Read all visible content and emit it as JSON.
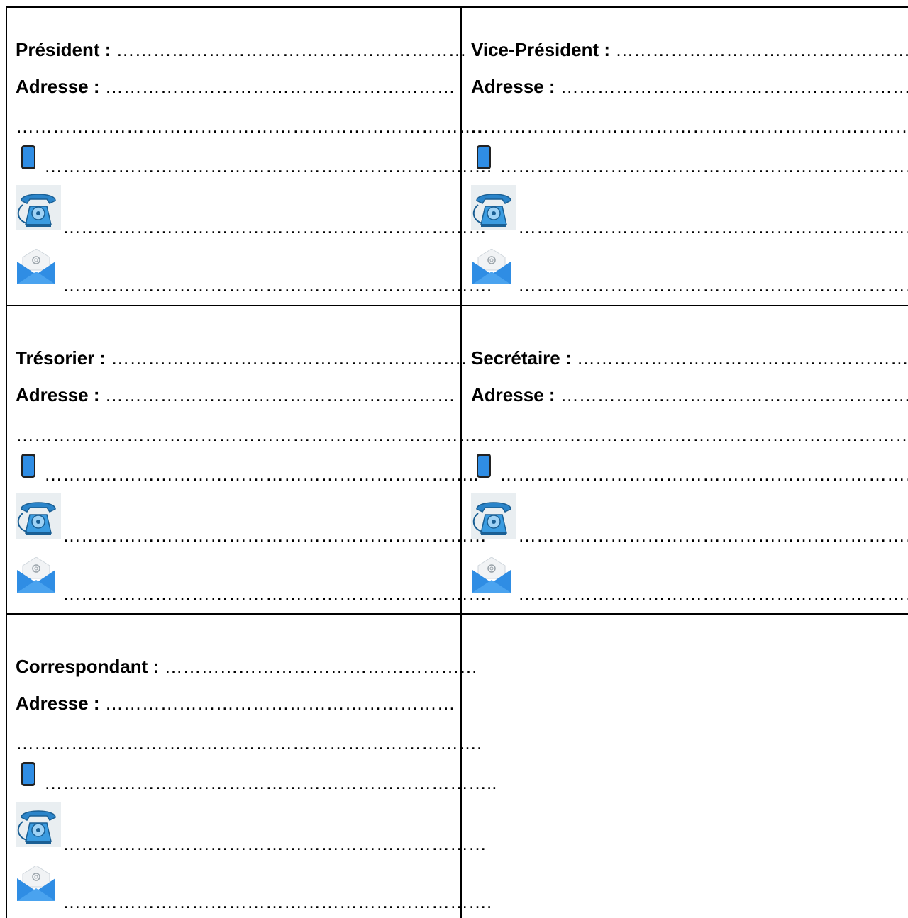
{
  "cards": [
    {
      "label": "Président",
      "sep": " :",
      "name_dots": " …………………………………………………",
      "address_label": "Adresse :",
      "address_dots": " …………………………………………………",
      "address_line2": "………………………………………………………………….",
      "mobile_dots": "……………………………………………………………….",
      "tel_dots": "……………………………………………………………",
      "email_dots": "……………………………………………………………."
    },
    {
      "label": "Vice-Président",
      "sep": " :",
      "name_dots": " ………………………………………………",
      "address_label": "Adresse :",
      "address_dots": " …………………………………………………",
      "address_line2": "……………………………………………………………….…",
      "mobile_dots": " ……………………………………………………………..",
      "tel_dots": "……………………………………………………………",
      "email_dots": " …………………………………………………………….."
    },
    {
      "label": "Trésorier",
      "sep": " :",
      "name_dots": " ………………………………………………….",
      "address_label": "Adresse :",
      "address_dots": " …………………………………………………",
      "address_line2": "………………………………………………………………….",
      "mobile_dots": " ……………………………………………………………..",
      "tel_dots": "……………………………………………………………",
      "email_dots": " ……………………………………………………………."
    },
    {
      "label": "Secrétaire",
      "sep": " :",
      "name_dots": " ………………………………………………",
      "address_label": "Adresse :",
      "address_dots": " …………………………………………………",
      "address_line2": "……………………………………………………………….…",
      "mobile_dots": " ……………………………………………………………..",
      "tel_dots": "……………………………………………………………",
      "email_dots": " …………………………………………………………….."
    },
    {
      "label": "Correspondant",
      "sep": " :",
      "name_dots": " ……………………………………………",
      "address_label": "Adresse :",
      "address_dots": " …………………………………………………",
      "address_line2": "………………………………………………………………….",
      "mobile_dots": " ………………………………………………………………..",
      "tel_dots": "……………………………………………………………",
      "email_dots": " ……………………………………………………………."
    }
  ],
  "icons": {
    "mobile": "mobile-phone-icon",
    "telephone": "telephone-icon",
    "email": "email-envelope-icon"
  },
  "colors": {
    "icon_blue": "#2f8de4",
    "border": "#000000"
  }
}
